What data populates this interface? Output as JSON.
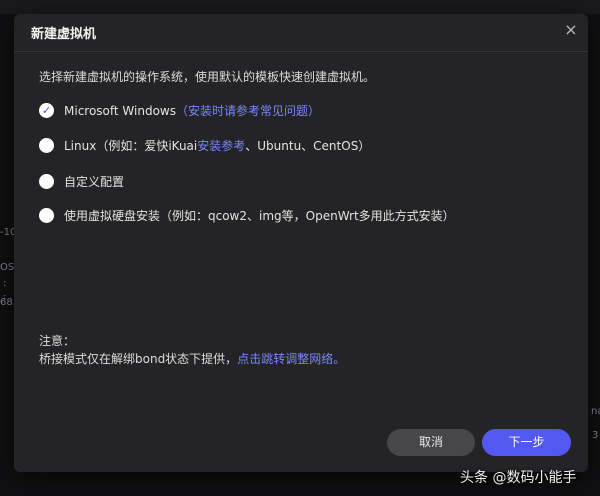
{
  "dialog": {
    "title": "新建虚拟机",
    "close_icon": "×",
    "intro": "选择新建虚拟机的操作系统，使用默认的模板快速创建虚拟机。",
    "options": [
      {
        "label": "Microsoft Windows",
        "link": "（安装时请参考常见问题）",
        "selected": true
      },
      {
        "label": "Linux（例如：爱快iKuai",
        "link": "安装参考",
        "suffix": "、Ubuntu、CentOS）",
        "selected": false
      },
      {
        "label": "自定义配置",
        "selected": false
      },
      {
        "label": "使用虚拟硬盘安装（例如：qcow2、img等，OpenWrt多用此方式安装）",
        "selected": false
      }
    ],
    "note_title": "注意：",
    "note_text": "桥接模式仅在解绑bond状态下提供，",
    "note_link": "点击跳转调整网络。",
    "cancel_label": "取消",
    "next_label": "下一步"
  },
  "background": {
    "left_fragments": [
      "-10",
      "OS",
      ":",
      ":",
      "68."
    ],
    "right_fragments": [
      "na",
      "3"
    ]
  },
  "watermark": "头条 @数码小能手",
  "colors": {
    "accent": "#5359f0",
    "link": "#7b86ff",
    "dialog_bg": "#242426"
  }
}
